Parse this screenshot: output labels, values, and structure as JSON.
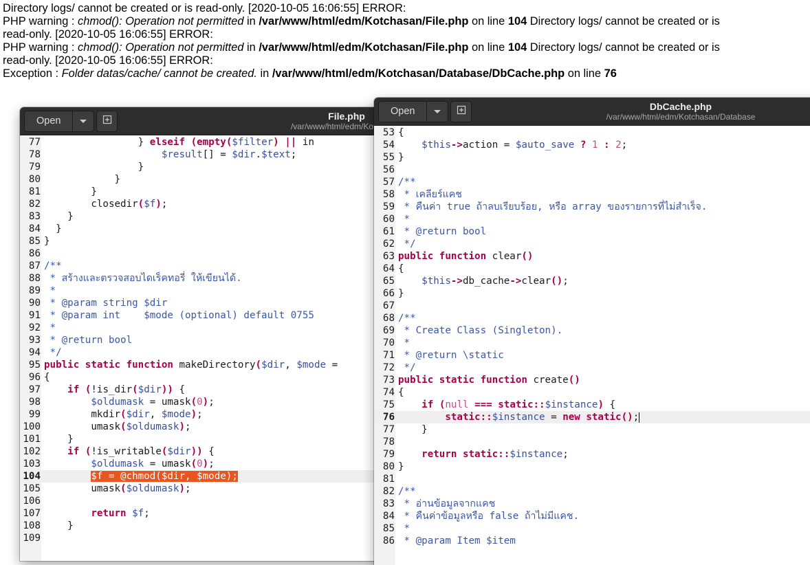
{
  "error_log": [
    {
      "segments": [
        {
          "t": "Directory logs/ cannot be created or is read-only. [2020-10-05 16:06:55] ERROR:",
          "s": "n"
        }
      ]
    },
    {
      "segments": [
        {
          "t": "PHP warning : ",
          "s": "n"
        },
        {
          "t": "chmod(): Operation not permitted",
          "s": "i"
        },
        {
          "t": " in ",
          "s": "n"
        },
        {
          "t": "/var/www/html/edm/Kotchasan/File.php",
          "s": "b"
        },
        {
          "t": " on line ",
          "s": "n"
        },
        {
          "t": "104",
          "s": "b"
        },
        {
          "t": " Directory logs/ cannot be created or is",
          "s": "n"
        }
      ]
    },
    {
      "segments": [
        {
          "t": "read-only. [2020-10-05 16:06:55] ERROR:",
          "s": "n"
        }
      ]
    },
    {
      "segments": [
        {
          "t": "PHP warning : ",
          "s": "n"
        },
        {
          "t": "chmod(): Operation not permitted",
          "s": "i"
        },
        {
          "t": " in ",
          "s": "n"
        },
        {
          "t": "/var/www/html/edm/Kotchasan/File.php",
          "s": "b"
        },
        {
          "t": " on line ",
          "s": "n"
        },
        {
          "t": "104",
          "s": "b"
        },
        {
          "t": " Directory logs/ cannot be created or is",
          "s": "n"
        }
      ]
    },
    {
      "segments": [
        {
          "t": "read-only. [2020-10-05 16:06:55] ERROR:",
          "s": "n"
        }
      ]
    },
    {
      "segments": [
        {
          "t": "Exception : ",
          "s": "n"
        },
        {
          "t": "Folder datas/cache/ cannot be created.",
          "s": "i"
        },
        {
          "t": " in ",
          "s": "n"
        },
        {
          "t": "/var/www/html/edm/Kotchasan/Database/DbCache.php",
          "s": "b"
        },
        {
          "t": " on line ",
          "s": "n"
        },
        {
          "t": "76",
          "s": "b"
        }
      ]
    }
  ],
  "file_window": {
    "open_label": "Open",
    "title": "File.php",
    "path": "/var/www/html/edm/Kotchasan",
    "current_line": 104,
    "lines": [
      {
        "n": 77,
        "tokens": [
          [
            "t",
            "                "
          ],
          [
            "t",
            "} "
          ],
          [
            "k",
            "elseif"
          ],
          [
            "t",
            " "
          ],
          [
            "p",
            "("
          ],
          [
            "k",
            "empty"
          ],
          [
            "p",
            "("
          ],
          [
            "v",
            "$filter"
          ],
          [
            "p",
            ")"
          ],
          [
            "t",
            " "
          ],
          [
            "p",
            "||"
          ],
          [
            "t",
            " in"
          ]
        ]
      },
      {
        "n": 78,
        "tokens": [
          [
            "t",
            "                    "
          ],
          [
            "v",
            "$result"
          ],
          [
            "t",
            "[] = "
          ],
          [
            "v",
            "$dir"
          ],
          [
            "t",
            "."
          ],
          [
            "v",
            "$text"
          ],
          [
            "t",
            ";"
          ]
        ]
      },
      {
        "n": 79,
        "tokens": [
          [
            "t",
            "                }"
          ]
        ]
      },
      {
        "n": 80,
        "tokens": [
          [
            "t",
            "            }"
          ]
        ]
      },
      {
        "n": 81,
        "tokens": [
          [
            "t",
            "        }"
          ]
        ]
      },
      {
        "n": 82,
        "tokens": [
          [
            "t",
            "        closedir"
          ],
          [
            "p",
            "("
          ],
          [
            "v",
            "$f"
          ],
          [
            "p",
            ")"
          ],
          [
            "t",
            ";"
          ]
        ]
      },
      {
        "n": 83,
        "tokens": [
          [
            "t",
            "    }"
          ]
        ]
      },
      {
        "n": 84,
        "tokens": [
          [
            "t",
            "  }"
          ]
        ]
      },
      {
        "n": 85,
        "tokens": [
          [
            "t",
            "}"
          ]
        ]
      },
      {
        "n": 86,
        "tokens": []
      },
      {
        "n": 87,
        "tokens": [
          [
            "c",
            "/**"
          ]
        ]
      },
      {
        "n": 88,
        "tokens": [
          [
            "c",
            " * สร้างและตรวจสอบไดเร็คทอรี่ ให้เขียนได้."
          ]
        ]
      },
      {
        "n": 89,
        "tokens": [
          [
            "c",
            " *"
          ]
        ]
      },
      {
        "n": 90,
        "tokens": [
          [
            "c",
            " * @param string $dir"
          ]
        ]
      },
      {
        "n": 91,
        "tokens": [
          [
            "c",
            " * @param int    $mode (optional) default 0755"
          ]
        ]
      },
      {
        "n": 92,
        "tokens": [
          [
            "c",
            " *"
          ]
        ]
      },
      {
        "n": 93,
        "tokens": [
          [
            "c",
            " * @return bool"
          ]
        ]
      },
      {
        "n": 94,
        "tokens": [
          [
            "c",
            " */"
          ]
        ]
      },
      {
        "n": 95,
        "tokens": [
          [
            "k",
            "public static function"
          ],
          [
            "t",
            " makeDirectory"
          ],
          [
            "p",
            "("
          ],
          [
            "v",
            "$dir"
          ],
          [
            "t",
            ", "
          ],
          [
            "v",
            "$mode"
          ],
          [
            "t",
            " ="
          ]
        ]
      },
      {
        "n": 96,
        "tokens": [
          [
            "t",
            "{"
          ]
        ]
      },
      {
        "n": 97,
        "tokens": [
          [
            "t",
            "    "
          ],
          [
            "k",
            "if"
          ],
          [
            "t",
            " "
          ],
          [
            "p",
            "("
          ],
          [
            "t",
            "!is_dir"
          ],
          [
            "p",
            "("
          ],
          [
            "v",
            "$dir"
          ],
          [
            "p",
            "))"
          ],
          [
            "t",
            " {"
          ]
        ]
      },
      {
        "n": 98,
        "tokens": [
          [
            "t",
            "        "
          ],
          [
            "v",
            "$oldumask"
          ],
          [
            "t",
            " = umask"
          ],
          [
            "p",
            "("
          ],
          [
            "m",
            "0"
          ],
          [
            "p",
            ")"
          ],
          [
            "t",
            ";"
          ]
        ]
      },
      {
        "n": 99,
        "tokens": [
          [
            "t",
            "        mkdir"
          ],
          [
            "p",
            "("
          ],
          [
            "v",
            "$dir"
          ],
          [
            "t",
            ", "
          ],
          [
            "v",
            "$mode"
          ],
          [
            "p",
            ")"
          ],
          [
            "t",
            ";"
          ]
        ]
      },
      {
        "n": 100,
        "tokens": [
          [
            "t",
            "        umask"
          ],
          [
            "p",
            "("
          ],
          [
            "v",
            "$oldumask"
          ],
          [
            "p",
            ")"
          ],
          [
            "t",
            ";"
          ]
        ]
      },
      {
        "n": 101,
        "tokens": [
          [
            "t",
            "    }"
          ]
        ]
      },
      {
        "n": 102,
        "tokens": [
          [
            "t",
            "    "
          ],
          [
            "k",
            "if"
          ],
          [
            "t",
            " "
          ],
          [
            "p",
            "("
          ],
          [
            "t",
            "!is_writable"
          ],
          [
            "p",
            "("
          ],
          [
            "v",
            "$dir"
          ],
          [
            "p",
            "))"
          ],
          [
            "t",
            " {"
          ]
        ]
      },
      {
        "n": 103,
        "tokens": [
          [
            "t",
            "        "
          ],
          [
            "v",
            "$oldumask"
          ],
          [
            "t",
            " = umask"
          ],
          [
            "p",
            "("
          ],
          [
            "m",
            "0"
          ],
          [
            "p",
            ")"
          ],
          [
            "t",
            ";"
          ]
        ]
      },
      {
        "n": 104,
        "tokens": [
          [
            "t",
            "        "
          ],
          [
            "hl",
            "$f = @chmod($dir, $mode);"
          ]
        ]
      },
      {
        "n": 105,
        "tokens": [
          [
            "t",
            "        umask"
          ],
          [
            "p",
            "("
          ],
          [
            "v",
            "$oldumask"
          ],
          [
            "p",
            ")"
          ],
          [
            "t",
            ";"
          ]
        ]
      },
      {
        "n": 106,
        "tokens": []
      },
      {
        "n": 107,
        "tokens": [
          [
            "t",
            "        "
          ],
          [
            "k",
            "return"
          ],
          [
            "t",
            " "
          ],
          [
            "v",
            "$f"
          ],
          [
            "t",
            ";"
          ]
        ]
      },
      {
        "n": 108,
        "tokens": [
          [
            "t",
            "    }"
          ]
        ]
      },
      {
        "n": 109,
        "tokens": []
      }
    ]
  },
  "db_window": {
    "open_label": "Open",
    "title": "DbCache.php",
    "path": "/var/www/html/edm/Kotchasan/Database",
    "current_line": 76,
    "lines": [
      {
        "n": 53,
        "tokens": [
          [
            "t",
            "{"
          ]
        ]
      },
      {
        "n": 54,
        "tokens": [
          [
            "t",
            "    "
          ],
          [
            "v",
            "$this"
          ],
          [
            "p",
            "->"
          ],
          [
            "t",
            "action = "
          ],
          [
            "v",
            "$auto_save"
          ],
          [
            "t",
            " "
          ],
          [
            "p",
            "?"
          ],
          [
            "t",
            " "
          ],
          [
            "m",
            "1"
          ],
          [
            "t",
            " "
          ],
          [
            "p",
            ":"
          ],
          [
            "t",
            " "
          ],
          [
            "m",
            "2"
          ],
          [
            "t",
            ";"
          ]
        ]
      },
      {
        "n": 55,
        "tokens": [
          [
            "t",
            "}"
          ]
        ]
      },
      {
        "n": 56,
        "tokens": []
      },
      {
        "n": 57,
        "tokens": [
          [
            "c",
            "/**"
          ]
        ]
      },
      {
        "n": 58,
        "tokens": [
          [
            "c",
            " * เคลียร์แคช"
          ]
        ]
      },
      {
        "n": 59,
        "tokens": [
          [
            "c",
            " * คืนค่า true ถ้าลบเรียบร้อย, หรือ array ของรายการที่ไม่สำเร็จ."
          ]
        ]
      },
      {
        "n": 60,
        "tokens": [
          [
            "c",
            " *"
          ]
        ]
      },
      {
        "n": 61,
        "tokens": [
          [
            "c",
            " * @return bool"
          ]
        ]
      },
      {
        "n": 62,
        "tokens": [
          [
            "c",
            " */"
          ]
        ]
      },
      {
        "n": 63,
        "tokens": [
          [
            "k",
            "public function"
          ],
          [
            "t",
            " clear"
          ],
          [
            "p",
            "()"
          ]
        ]
      },
      {
        "n": 64,
        "tokens": [
          [
            "t",
            "{"
          ]
        ]
      },
      {
        "n": 65,
        "tokens": [
          [
            "t",
            "    "
          ],
          [
            "v",
            "$this"
          ],
          [
            "p",
            "->"
          ],
          [
            "t",
            "db_cache"
          ],
          [
            "p",
            "->"
          ],
          [
            "t",
            "clear"
          ],
          [
            "p",
            "()"
          ],
          [
            "t",
            ";"
          ]
        ]
      },
      {
        "n": 66,
        "tokens": [
          [
            "t",
            "}"
          ]
        ]
      },
      {
        "n": 67,
        "tokens": []
      },
      {
        "n": 68,
        "tokens": [
          [
            "c",
            "/**"
          ]
        ]
      },
      {
        "n": 69,
        "tokens": [
          [
            "c",
            " * Create Class (Singleton)."
          ]
        ]
      },
      {
        "n": 70,
        "tokens": [
          [
            "c",
            " *"
          ]
        ]
      },
      {
        "n": 71,
        "tokens": [
          [
            "c",
            " * @return \\static"
          ]
        ]
      },
      {
        "n": 72,
        "tokens": [
          [
            "c",
            " */"
          ]
        ]
      },
      {
        "n": 73,
        "tokens": [
          [
            "k",
            "public static function"
          ],
          [
            "t",
            " create"
          ],
          [
            "p",
            "()"
          ]
        ]
      },
      {
        "n": 74,
        "tokens": [
          [
            "t",
            "{"
          ]
        ]
      },
      {
        "n": 75,
        "tokens": [
          [
            "t",
            "    "
          ],
          [
            "k",
            "if"
          ],
          [
            "t",
            " "
          ],
          [
            "p",
            "("
          ],
          [
            "m",
            "null"
          ],
          [
            "t",
            " "
          ],
          [
            "p",
            "==="
          ],
          [
            "t",
            " "
          ],
          [
            "k",
            "static"
          ],
          [
            "p",
            "::"
          ],
          [
            "v",
            "$instance"
          ],
          [
            "p",
            ")"
          ],
          [
            "t",
            " {"
          ]
        ]
      },
      {
        "n": 76,
        "tokens": [
          [
            "t",
            "        "
          ],
          [
            "k",
            "static"
          ],
          [
            "p",
            "::"
          ],
          [
            "v",
            "$instance"
          ],
          [
            "t",
            " = "
          ],
          [
            "k",
            "new static"
          ],
          [
            "p",
            "()"
          ],
          [
            "t",
            ";"
          ],
          [
            "cursor",
            ""
          ]
        ]
      },
      {
        "n": 77,
        "tokens": [
          [
            "t",
            "    }"
          ]
        ]
      },
      {
        "n": 78,
        "tokens": []
      },
      {
        "n": 79,
        "tokens": [
          [
            "t",
            "    "
          ],
          [
            "k",
            "return"
          ],
          [
            "t",
            " "
          ],
          [
            "k",
            "static"
          ],
          [
            "p",
            "::"
          ],
          [
            "v",
            "$instance"
          ],
          [
            "t",
            ";"
          ]
        ]
      },
      {
        "n": 80,
        "tokens": [
          [
            "t",
            "}"
          ]
        ]
      },
      {
        "n": 81,
        "tokens": []
      },
      {
        "n": 82,
        "tokens": [
          [
            "c",
            "/**"
          ]
        ]
      },
      {
        "n": 83,
        "tokens": [
          [
            "c",
            " * อ่านข้อมูลจากแคช"
          ]
        ]
      },
      {
        "n": 84,
        "tokens": [
          [
            "c",
            " * คืนค่าข้อมูลหรือ false ถ้าไม่มีแคช."
          ]
        ]
      },
      {
        "n": 85,
        "tokens": [
          [
            "c",
            " *"
          ]
        ]
      },
      {
        "n": 86,
        "tokens": [
          [
            "c",
            " * @param Item $item"
          ]
        ]
      }
    ]
  }
}
